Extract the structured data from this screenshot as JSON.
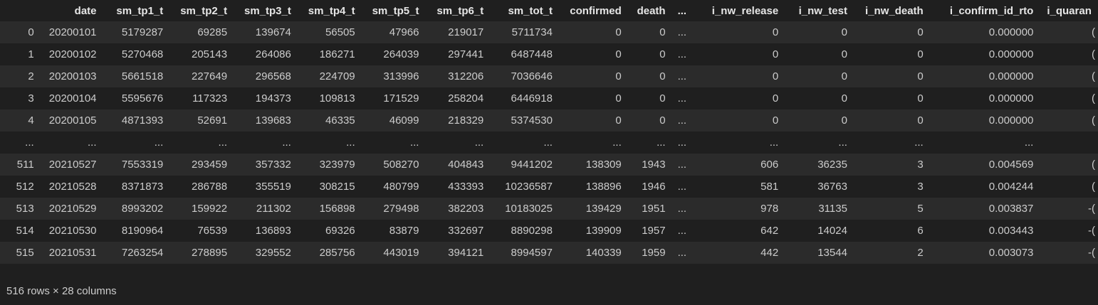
{
  "table": {
    "columns": [
      "date",
      "sm_tp1_t",
      "sm_tp2_t",
      "sm_tp3_t",
      "sm_tp4_t",
      "sm_tp5_t",
      "sm_tp6_t",
      "sm_tot_t",
      "confirmed",
      "death",
      "...",
      "i_nw_release",
      "i_nw_test",
      "i_nw_death",
      "i_confirm_id_rto",
      "i_quaran"
    ],
    "rows": [
      {
        "index": "0",
        "cells": [
          "20200101",
          "5179287",
          "69285",
          "139674",
          "56505",
          "47966",
          "219017",
          "5711734",
          "0",
          "0",
          "...",
          "0",
          "0",
          "0",
          "0.000000",
          "("
        ]
      },
      {
        "index": "1",
        "cells": [
          "20200102",
          "5270468",
          "205143",
          "264086",
          "186271",
          "264039",
          "297441",
          "6487448",
          "0",
          "0",
          "...",
          "0",
          "0",
          "0",
          "0.000000",
          "("
        ]
      },
      {
        "index": "2",
        "cells": [
          "20200103",
          "5661518",
          "227649",
          "296568",
          "224709",
          "313996",
          "312206",
          "7036646",
          "0",
          "0",
          "...",
          "0",
          "0",
          "0",
          "0.000000",
          "("
        ]
      },
      {
        "index": "3",
        "cells": [
          "20200104",
          "5595676",
          "117323",
          "194373",
          "109813",
          "171529",
          "258204",
          "6446918",
          "0",
          "0",
          "...",
          "0",
          "0",
          "0",
          "0.000000",
          "("
        ]
      },
      {
        "index": "4",
        "cells": [
          "20200105",
          "4871393",
          "52691",
          "139683",
          "46335",
          "46099",
          "218329",
          "5374530",
          "0",
          "0",
          "...",
          "0",
          "0",
          "0",
          "0.000000",
          "("
        ]
      },
      {
        "index": "...",
        "cells": [
          "...",
          "...",
          "...",
          "...",
          "...",
          "...",
          "...",
          "...",
          "...",
          "...",
          "...",
          "...",
          "...",
          "...",
          "...",
          ""
        ]
      },
      {
        "index": "511",
        "cells": [
          "20210527",
          "7553319",
          "293459",
          "357332",
          "323979",
          "508270",
          "404843",
          "9441202",
          "138309",
          "1943",
          "...",
          "606",
          "36235",
          "3",
          "0.004569",
          "("
        ]
      },
      {
        "index": "512",
        "cells": [
          "20210528",
          "8371873",
          "286788",
          "355519",
          "308215",
          "480799",
          "433393",
          "10236587",
          "138896",
          "1946",
          "...",
          "581",
          "36763",
          "3",
          "0.004244",
          "("
        ]
      },
      {
        "index": "513",
        "cells": [
          "20210529",
          "8993202",
          "159922",
          "211302",
          "156898",
          "279498",
          "382203",
          "10183025",
          "139429",
          "1951",
          "...",
          "978",
          "31135",
          "5",
          "0.003837",
          "-("
        ]
      },
      {
        "index": "514",
        "cells": [
          "20210530",
          "8190964",
          "76539",
          "136893",
          "69326",
          "83879",
          "332697",
          "8890298",
          "139909",
          "1957",
          "...",
          "642",
          "14024",
          "6",
          "0.003443",
          "-("
        ]
      },
      {
        "index": "515",
        "cells": [
          "20210531",
          "7263254",
          "278895",
          "329552",
          "285756",
          "443019",
          "394121",
          "8994597",
          "140339",
          "1959",
          "...",
          "442",
          "13544",
          "2",
          "0.003073",
          "-("
        ]
      }
    ]
  },
  "shape_note": "516 rows × 28 columns"
}
